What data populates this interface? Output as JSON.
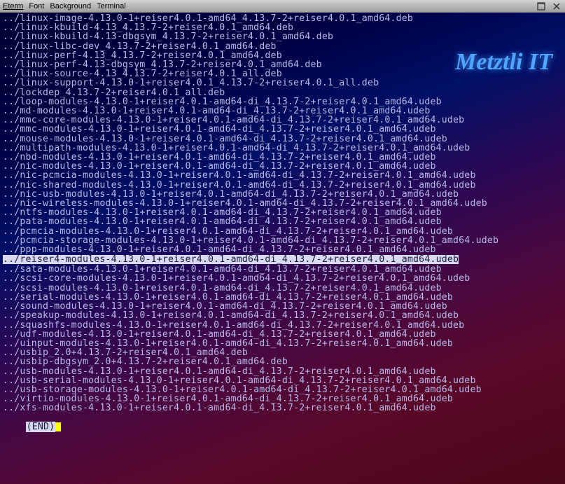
{
  "titlebar": {
    "menu": [
      "Eterm",
      "Font",
      "Background",
      "Terminal"
    ],
    "maximize_title": "Maximize",
    "close_title": "Close"
  },
  "watermark": "Metztli IT",
  "highlighted_index": 29,
  "lines": [
    "../linux-image-4.13.0-1+reiser4.0.1-amd64_4.13.7-2+reiser4.0.1_amd64.deb",
    "../linux-kbuild-4.13_4.13.7-2+reiser4.0.1_amd64.deb",
    "../linux-kbuild-4.13-dbgsym_4.13.7-2+reiser4.0.1_amd64.deb",
    "../linux-libc-dev_4.13.7-2+reiser4.0.1_amd64.deb",
    "../linux-perf-4.13_4.13.7-2+reiser4.0.1_amd64.deb",
    "../linux-perf-4.13-dbgsym_4.13.7-2+reiser4.0.1_amd64.deb",
    "../linux-source-4.13_4.13.7-2+reiser4.0.1_all.deb",
    "../linux-support-4.13.0-1+reiser4.0.1_4.13.7-2+reiser4.0.1_all.deb",
    "../lockdep_4.13.7-2+reiser4.0.1_all.deb",
    "../loop-modules-4.13.0-1+reiser4.0.1-amd64-di_4.13.7-2+reiser4.0.1_amd64.udeb",
    "../md-modules-4.13.0-1+reiser4.0.1-amd64-di_4.13.7-2+reiser4.0.1_amd64.udeb",
    "../mmc-core-modules-4.13.0-1+reiser4.0.1-amd64-di_4.13.7-2+reiser4.0.1_amd64.udeb",
    "../mmc-modules-4.13.0-1+reiser4.0.1-amd64-di_4.13.7-2+reiser4.0.1_amd64.udeb",
    "../mouse-modules-4.13.0-1+reiser4.0.1-amd64-di_4.13.7-2+reiser4.0.1_amd64.udeb",
    "../multipath-modules-4.13.0-1+reiser4.0.1-amd64-di_4.13.7-2+reiser4.0.1_amd64.udeb",
    "../nbd-modules-4.13.0-1+reiser4.0.1-amd64-di_4.13.7-2+reiser4.0.1_amd64.udeb",
    "../nic-modules-4.13.0-1+reiser4.0.1-amd64-di_4.13.7-2+reiser4.0.1_amd64.udeb",
    "../nic-pcmcia-modules-4.13.0-1+reiser4.0.1-amd64-di_4.13.7-2+reiser4.0.1_amd64.udeb",
    "../nic-shared-modules-4.13.0-1+reiser4.0.1-amd64-di_4.13.7-2+reiser4.0.1_amd64.udeb",
    "../nic-usb-modules-4.13.0-1+reiser4.0.1-amd64-di_4.13.7-2+reiser4.0.1_amd64.udeb",
    "../nic-wireless-modules-4.13.0-1+reiser4.0.1-amd64-di_4.13.7-2+reiser4.0.1_amd64.udeb",
    "../ntfs-modules-4.13.0-1+reiser4.0.1-amd64-di_4.13.7-2+reiser4.0.1_amd64.udeb",
    "../pata-modules-4.13.0-1+reiser4.0.1-amd64-di_4.13.7-2+reiser4.0.1_amd64.udeb",
    "../pcmcia-modules-4.13.0-1+reiser4.0.1-amd64-di_4.13.7-2+reiser4.0.1_amd64.udeb",
    "../pcmcia-storage-modules-4.13.0-1+reiser4.0.1-amd64-di_4.13.7-2+reiser4.0.1_amd64.udeb",
    "../ppp-modules-4.13.0-1+reiser4.0.1-amd64-di_4.13.7-2+reiser4.0.1_amd64.udeb",
    "../reiser4-modules-4.13.0-1+reiser4.0.1-amd64-di_4.13.7-2+reiser4.0.1_amd64.udeb",
    "../sata-modules-4.13.0-1+reiser4.0.1-amd64-di_4.13.7-2+reiser4.0.1_amd64.udeb",
    "../scsi-core-modules-4.13.0-1+reiser4.0.1-amd64-di_4.13.7-2+reiser4.0.1_amd64.udeb",
    "../scsi-modules-4.13.0-1+reiser4.0.1-amd64-di_4.13.7-2+reiser4.0.1_amd64.udeb",
    "../serial-modules-4.13.0-1+reiser4.0.1-amd64-di_4.13.7-2+reiser4.0.1_amd64.udeb",
    "../sound-modules-4.13.0-1+reiser4.0.1-amd64-di_4.13.7-2+reiser4.0.1_amd64.udeb",
    "../speakup-modules-4.13.0-1+reiser4.0.1-amd64-di_4.13.7-2+reiser4.0.1_amd64.udeb",
    "../squashfs-modules-4.13.0-1+reiser4.0.1-amd64-di_4.13.7-2+reiser4.0.1_amd64.udeb",
    "../udf-modules-4.13.0-1+reiser4.0.1-amd64-di_4.13.7-2+reiser4.0.1_amd64.udeb",
    "../uinput-modules-4.13.0-1+reiser4.0.1-amd64-di_4.13.7-2+reiser4.0.1_amd64.udeb",
    "../usbip_2.0+4.13.7-2+reiser4.0.1_amd64.deb",
    "../usbip-dbgsym_2.0+4.13.7-2+reiser4.0.1_amd64.deb",
    "../usb-modules-4.13.0-1+reiser4.0.1-amd64-di_4.13.7-2+reiser4.0.1_amd64.udeb",
    "../usb-serial-modules-4.13.0-1+reiser4.0.1-amd64-di_4.13.7-2+reiser4.0.1_amd64.udeb",
    "../usb-storage-modules-4.13.0-1+reiser4.0.1-amd64-di_4.13.7-2+reiser4.0.1_amd64.udeb",
    "../virtio-modules-4.13.0-1+reiser4.0.1-amd64-di_4.13.7-2+reiser4.0.1_amd64.udeb",
    "../xfs-modules-4.13.0-1+reiser4.0.1-amd64-di_4.13.7-2+reiser4.0.1_amd64.udeb"
  ],
  "end_marker": "(END)"
}
